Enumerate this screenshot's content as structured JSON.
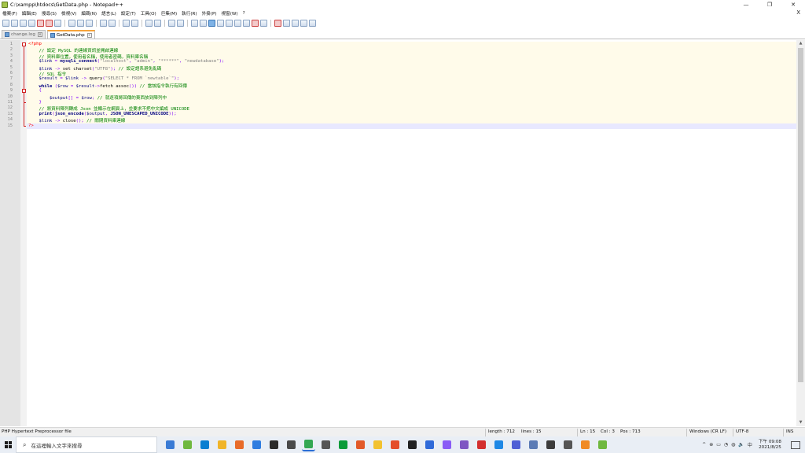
{
  "window": {
    "title": "C:\\xampp\\htdocs\\GetData.php - Notepad++",
    "controls": [
      "—",
      "❐",
      "✕"
    ]
  },
  "menu": {
    "items": [
      "檔案(F)",
      "編輯(E)",
      "搜尋(S)",
      "檢視(V)",
      "編碼(N)",
      "語言(L)",
      "設定(T)",
      "工具(O)",
      "巨集(M)",
      "執行(R)",
      "外掛(P)",
      "視窗(W)",
      "?"
    ],
    "close": "X"
  },
  "tabs": [
    {
      "label": "change.log",
      "active": false
    },
    {
      "label": "GetData.php",
      "active": true
    }
  ],
  "editor": {
    "current_line": 15,
    "lines": [
      {
        "n": "1",
        "tokens": [
          [
            "c-tag",
            "<?php"
          ]
        ]
      },
      {
        "n": "2",
        "tokens": [
          [
            "c-cm",
            "    // 設定 MySQL 的連線資訊並開啟連線"
          ]
        ]
      },
      {
        "n": "3",
        "tokens": [
          [
            "c-cm",
            "    // 資料庫位置，使用者名稱，使用者密碼，資料庫名稱"
          ]
        ]
      },
      {
        "n": "4",
        "tokens": [
          [
            "c-var",
            "    $link"
          ],
          [
            "c-op",
            " = "
          ],
          [
            "c-fn",
            "mysqli_connect"
          ],
          [
            "c-op",
            "("
          ],
          [
            "c-str",
            "\"localhost\""
          ],
          [
            "c-op",
            ", "
          ],
          [
            "c-str",
            "\"admin\""
          ],
          [
            "c-op",
            ", "
          ],
          [
            "c-str",
            "\"******\""
          ],
          [
            "c-op",
            ", "
          ],
          [
            "c-str",
            "\"newdatabase\""
          ],
          [
            "c-op",
            ");"
          ]
        ]
      },
      {
        "n": "5",
        "tokens": [
          [
            "c-var",
            "    $link"
          ],
          [
            "c-op",
            " -> "
          ],
          [
            "c-plain",
            "set_charset"
          ],
          [
            "c-op",
            "("
          ],
          [
            "c-str",
            "\"UTF8\""
          ],
          [
            "c-op",
            "); "
          ],
          [
            "c-cm",
            "// 設定語系避免亂碼"
          ]
        ]
      },
      {
        "n": "6",
        "tokens": [
          [
            "c-cm",
            "    // SQL 指令"
          ]
        ]
      },
      {
        "n": "7",
        "tokens": [
          [
            "c-var",
            "    $result"
          ],
          [
            "c-op",
            " = "
          ],
          [
            "c-var",
            "$link"
          ],
          [
            "c-op",
            " -> "
          ],
          [
            "c-plain",
            "query"
          ],
          [
            "c-op",
            "("
          ],
          [
            "c-str",
            "\"SELECT * FROM `newtable`\""
          ],
          [
            "c-op",
            ");"
          ]
        ]
      },
      {
        "n": "8",
        "tokens": [
          [
            "c-kw",
            "    while"
          ],
          [
            "c-op",
            " ("
          ],
          [
            "c-var",
            "$row"
          ],
          [
            "c-op",
            " = "
          ],
          [
            "c-var",
            "$result"
          ],
          [
            "c-op",
            "->"
          ],
          [
            "c-plain",
            "fetch_assoc"
          ],
          [
            "c-op",
            "()) "
          ],
          [
            "c-cm",
            "// 當該指令執行有回傳"
          ]
        ]
      },
      {
        "n": "9",
        "tokens": [
          [
            "c-op",
            "    {"
          ]
        ]
      },
      {
        "n": "10",
        "tokens": [
          [
            "c-var",
            "        $output"
          ],
          [
            "c-op",
            "[] = "
          ],
          [
            "c-var",
            "$row"
          ],
          [
            "c-op",
            "; "
          ],
          [
            "c-cm",
            "// 就逐項將回傳的東西放到陣列中"
          ]
        ]
      },
      {
        "n": "11",
        "tokens": [
          [
            "c-op",
            "    }"
          ]
        ]
      },
      {
        "n": "12",
        "tokens": [
          [
            "c-cm",
            "    // 將資料陣列轉成 Json 並顯示在網頁上，並要求不把中文編成 UNICODE"
          ]
        ]
      },
      {
        "n": "13",
        "tokens": [
          [
            "c-fn",
            "    print"
          ],
          [
            "c-op",
            "("
          ],
          [
            "c-fn",
            "json_encode"
          ],
          [
            "c-op",
            "("
          ],
          [
            "c-var",
            "$output"
          ],
          [
            "c-op",
            ", "
          ],
          [
            "c-fn",
            "JSON_UNESCAPED_UNICODE"
          ],
          [
            "c-op",
            "));"
          ]
        ]
      },
      {
        "n": "14",
        "tokens": [
          [
            "c-var",
            "    $link"
          ],
          [
            "c-op",
            " -> "
          ],
          [
            "c-plain",
            "close"
          ],
          [
            "c-op",
            "(); "
          ],
          [
            "c-cm",
            "// 關閉資料庫連線"
          ]
        ]
      },
      {
        "n": "15",
        "tokens": [
          [
            "c-tag",
            "?>"
          ]
        ]
      }
    ]
  },
  "status": {
    "file_type": "PHP Hypertext Preprocessor file",
    "length": "length : 712",
    "lines": "lines : 15",
    "ln": "Ln : 15",
    "col": "Col : 3",
    "pos": "Pos : 713",
    "eol": "Windows (CR LF)",
    "encoding": "UTF-8",
    "mode": "INS"
  },
  "taskbar": {
    "search_placeholder": "在這裡輸入文字來搜尋",
    "app_colors": [
      "#3a7bd5",
      "#6fb83f",
      "#0b7fd1",
      "#f0b429",
      "#e86b2a",
      "#2f7de0",
      "#2b2b2b",
      "#4a4a4a",
      "#34a853",
      "#555555",
      "#0a9b3a",
      "#e25a2a",
      "#f2c230",
      "#e44d2a",
      "#222222",
      "#2f6ad9",
      "#8a5cf6",
      "#7e57c2",
      "#d32f2f",
      "#1e88e5",
      "#4f5fd5",
      "#5b7bb5",
      "#3c3c3c",
      "#555555",
      "#f08a24",
      "#6fb83f"
    ],
    "active_app": 8,
    "tray_icons": [
      "^",
      "⊕",
      "▭",
      "◔",
      "◍",
      "🔈",
      "中"
    ],
    "clock_time": "下午 09:08",
    "clock_date": "2021/8/25"
  }
}
